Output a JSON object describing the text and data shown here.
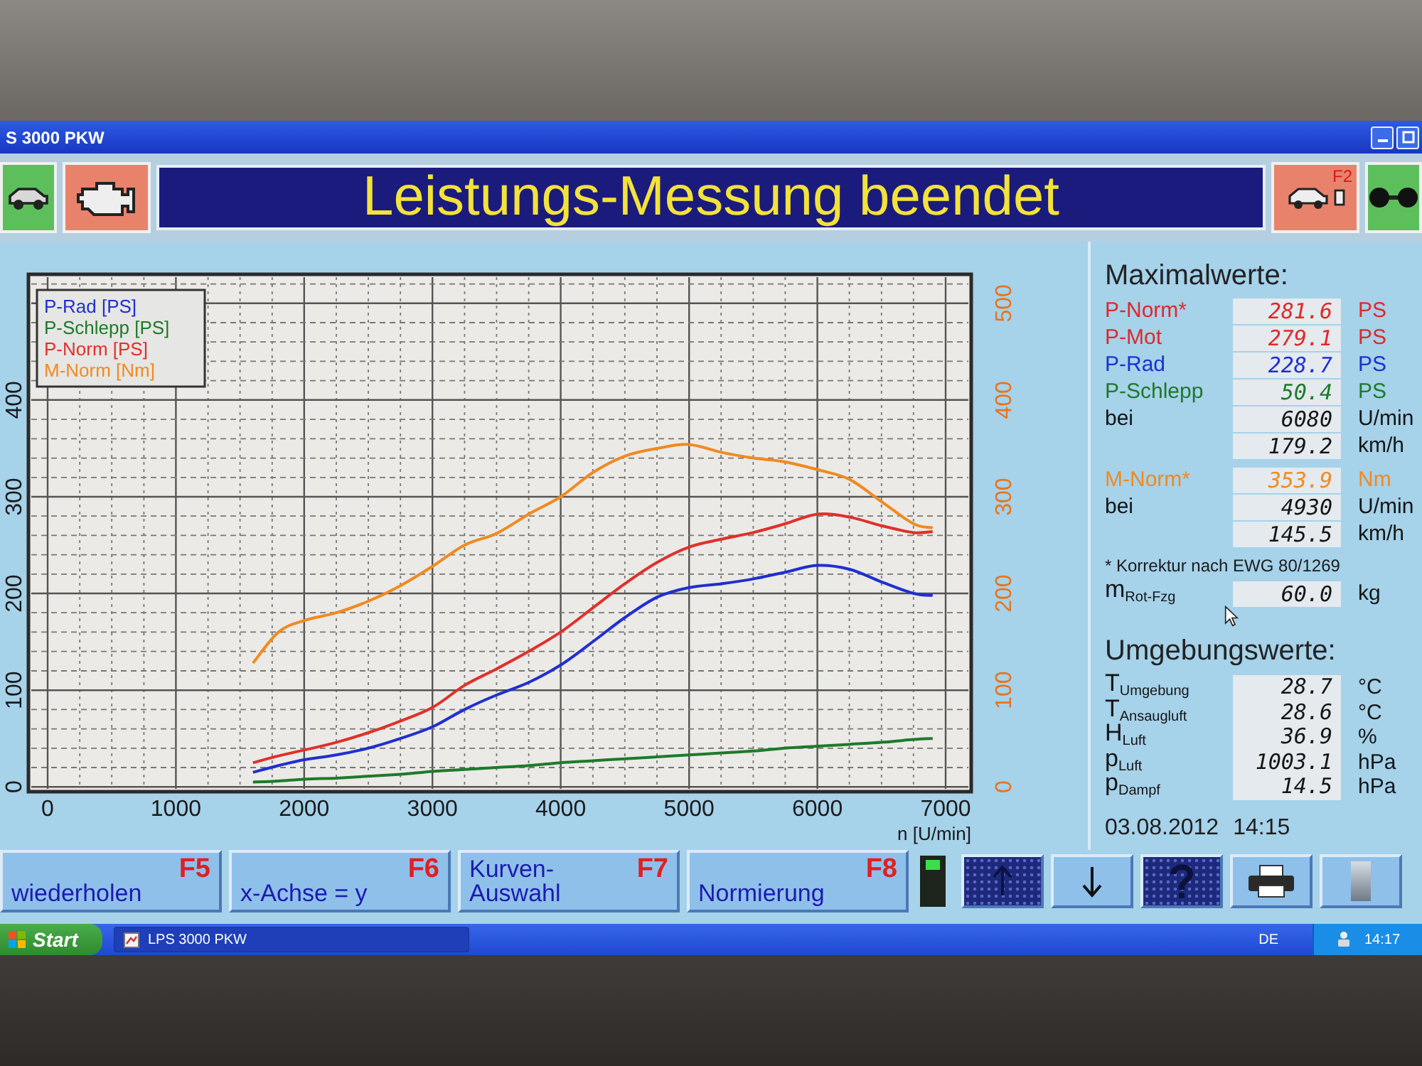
{
  "window": {
    "title": "S 3000 PKW"
  },
  "header": {
    "left_tiles": [
      {
        "kind": "car",
        "color": "#5cbf5c"
      },
      {
        "kind": "engine",
        "color": "#e9826b"
      }
    ],
    "banner": "Leistungs-Messung beendet",
    "right_tiles": [
      {
        "kind": "dyno",
        "key": "F2",
        "color": "#e9826b"
      },
      {
        "kind": "wheels",
        "color": "#5cbf5c"
      }
    ]
  },
  "chart": {
    "chart_data": {
      "type": "line",
      "xlabel": "n [U/min]",
      "x": [
        1600,
        1800,
        2000,
        2250,
        2500,
        2750,
        3000,
        3250,
        3500,
        3750,
        4000,
        4250,
        4500,
        4750,
        5000,
        5250,
        5500,
        5750,
        6000,
        6250,
        6500,
        6750,
        6900
      ],
      "series": [
        {
          "name": "P-Rad [PS]",
          "color": "#1f2fd0",
          "values": [
            15,
            22,
            28,
            33,
            40,
            50,
            62,
            80,
            95,
            108,
            126,
            150,
            175,
            196,
            206,
            210,
            215,
            222,
            229,
            225,
            212,
            200,
            198
          ]
        },
        {
          "name": "P-Schlepp [PS]",
          "color": "#1e7a2a",
          "values": [
            5,
            6,
            8,
            9,
            11,
            13,
            16,
            18,
            20,
            22,
            25,
            27,
            29,
            31,
            33,
            35,
            37,
            40,
            42,
            44,
            46,
            49,
            50
          ]
        },
        {
          "name": "P-Norm [PS]",
          "color": "#e0302a",
          "values": [
            25,
            32,
            38,
            46,
            56,
            68,
            82,
            105,
            122,
            140,
            160,
            185,
            210,
            232,
            248,
            256,
            263,
            272,
            282,
            279,
            270,
            263,
            264
          ]
        },
        {
          "name": "M-Norm [Nm]",
          "color": "#f08a20",
          "values": [
            128,
            160,
            172,
            180,
            192,
            208,
            228,
            250,
            262,
            282,
            300,
            325,
            342,
            350,
            354,
            346,
            340,
            336,
            328,
            318,
            295,
            272,
            268
          ]
        }
      ],
      "xlim": [
        -150,
        7200
      ],
      "ylim": [
        -5,
        530
      ],
      "y2lim": [
        -5,
        530
      ],
      "xticks": [
        0,
        1000,
        2000,
        3000,
        4000,
        5000,
        6000,
        7000
      ],
      "yticks": [
        0,
        100,
        200,
        300,
        400
      ],
      "y2ticks": [
        0,
        100,
        200,
        300,
        400,
        500
      ],
      "grid": true
    }
  },
  "max_values": {
    "title": "Maximalwerte:",
    "groups": [
      {
        "rows": [
          {
            "label": "P-Norm*",
            "value": "281.6",
            "unit": "PS",
            "color": "#e02828"
          },
          {
            "label": "P-Mot",
            "value": "279.1",
            "unit": "PS",
            "color": "#e02828"
          },
          {
            "label": "P-Rad",
            "value": "228.7",
            "unit": "PS",
            "color": "#1f2fd0"
          },
          {
            "label": "P-Schlepp",
            "value": "50.4",
            "unit": "PS",
            "color": "#1e7a2a"
          },
          {
            "label": "bei",
            "value": "6080",
            "unit": "U/min",
            "color": "#151515"
          },
          {
            "value": "179.2",
            "unit": "km/h",
            "color": "#151515"
          }
        ]
      },
      {
        "rows": [
          {
            "label": "M-Norm*",
            "value": "353.9",
            "unit": "Nm",
            "color": "#f08a20"
          },
          {
            "label": "bei",
            "value": "4930",
            "unit": "U/min",
            "color": "#151515"
          },
          {
            "value": "145.5",
            "unit": "km/h",
            "color": "#151515"
          }
        ]
      }
    ],
    "footnote": "* Korrektur nach EWG 80/1269",
    "mass": {
      "label": "m$_{Rot-Fzg}$",
      "value": "60.0",
      "unit": "kg"
    }
  },
  "environment": {
    "title": "Umgebungswerte:",
    "rows": [
      {
        "label": "T$_{Umgebung}$",
        "value": "28.7",
        "unit": "°C"
      },
      {
        "label": "T$_{Ansaugluft}$",
        "value": "28.6",
        "unit": "°C"
      },
      {
        "label": "H$_{Luft}$",
        "value": "36.9",
        "unit": "%"
      },
      {
        "label": "p$_{Luft}$",
        "value": "1003.1",
        "unit": "hPa"
      },
      {
        "label": "p$_{Dampf}$",
        "value": "14.5",
        "unit": "hPa"
      }
    ]
  },
  "timestamp": {
    "date": "03.08.2012",
    "time": "14:15"
  },
  "function_keys": [
    {
      "label": "wiederholen",
      "key": "F5"
    },
    {
      "label": "x-Achse = y",
      "key": "F6"
    },
    {
      "label": "Kurven-Auswahl",
      "key": "F7"
    },
    {
      "label": "Normierung",
      "key": "F8"
    }
  ],
  "indicator": {
    "on": true
  },
  "tool_buttons": [
    {
      "kind": "up",
      "disabled": true
    },
    {
      "kind": "down",
      "disabled": false
    },
    {
      "kind": "help",
      "disabled": true
    },
    {
      "kind": "print",
      "disabled": false
    },
    {
      "kind": "bar",
      "disabled": false
    }
  ],
  "taskbar": {
    "start": "Start",
    "items": [
      {
        "label": "LPS 3000 PKW"
      }
    ],
    "language": "DE",
    "clock": "14:17"
  }
}
